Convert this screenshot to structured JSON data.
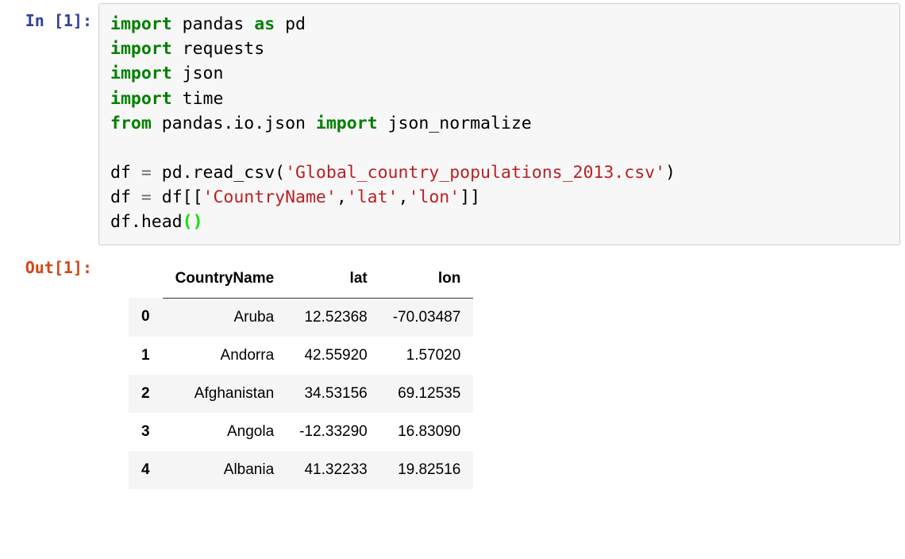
{
  "input": {
    "prompt": "In [1]:",
    "tokens": {
      "import": "import",
      "pandas": "pandas",
      "as": "as",
      "pd": "pd",
      "requests": "requests",
      "json": "json",
      "time": "time",
      "from": "from",
      "pandas_io_json": "pandas.io.json",
      "json_normalize": "json_normalize",
      "df": "df",
      "eq": "=",
      "read_csv": "pd.read_csv",
      "csv_file": "'Global_country_populations_2013.csv'",
      "cols_open": "df[[",
      "c1": "'CountryName'",
      "comma": ",",
      "c2": "'lat'",
      "c3": "'lon'",
      "cols_close": "]]",
      "head": "df.head",
      "paren_open": "(",
      "paren_close": ")"
    }
  },
  "output": {
    "prompt": "Out[1]:",
    "dataframe": {
      "columns": [
        "CountryName",
        "lat",
        "lon"
      ],
      "index": [
        "0",
        "1",
        "2",
        "3",
        "4"
      ],
      "rows": [
        {
          "CountryName": "Aruba",
          "lat": "12.52368",
          "lon": "-70.03487"
        },
        {
          "CountryName": "Andorra",
          "lat": "42.55920",
          "lon": "1.57020"
        },
        {
          "CountryName": "Afghanistan",
          "lat": "34.53156",
          "lon": "69.12535"
        },
        {
          "CountryName": "Angola",
          "lat": "-12.33290",
          "lon": "16.83090"
        },
        {
          "CountryName": "Albania",
          "lat": "41.32233",
          "lon": "19.82516"
        }
      ]
    }
  }
}
